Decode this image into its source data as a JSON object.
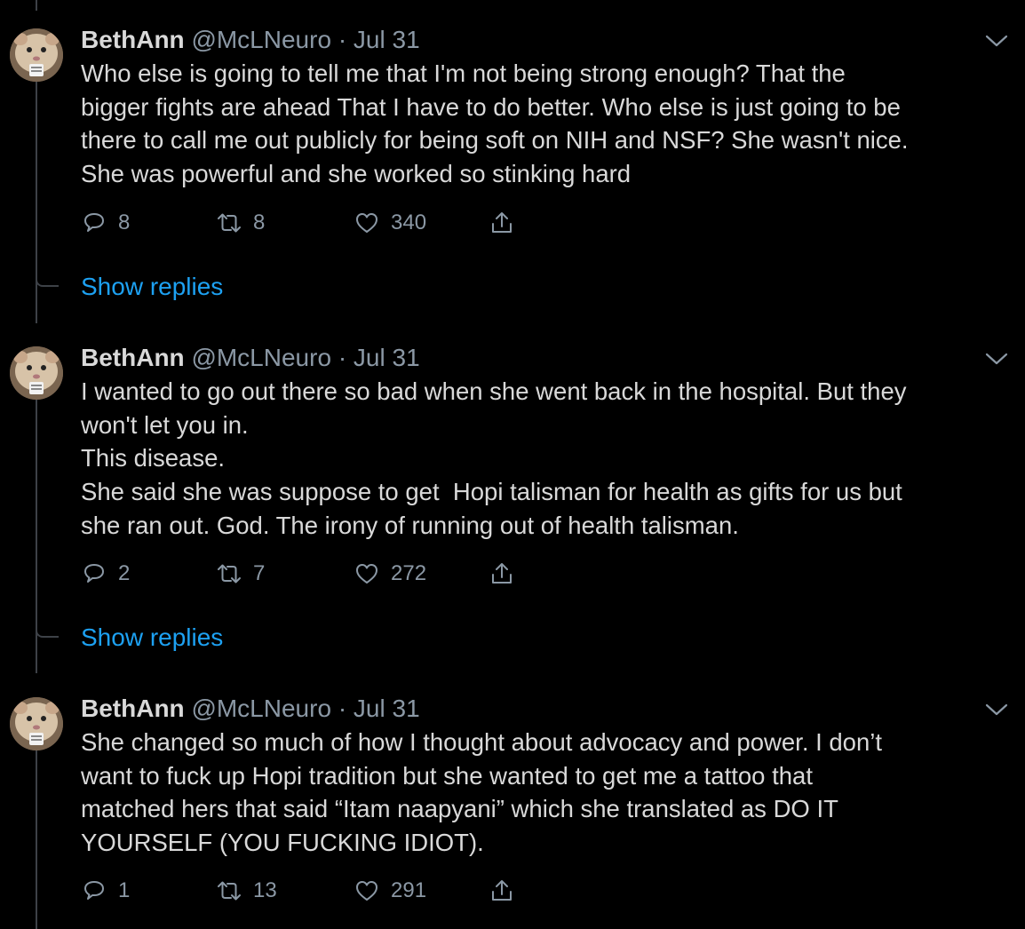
{
  "colors": {
    "background": "#000000",
    "text": "#d9d9d9",
    "muted": "#8b98a5",
    "link": "#1da1f2",
    "thread_line": "#3d4147"
  },
  "show_replies_label": "Show replies",
  "tweets": [
    {
      "name": "BethAnn",
      "handle": "@McLNeuro",
      "separator": "·",
      "date": "Jul 31",
      "lines": [
        "Who else is going to tell me that I'm not being strong enough? That the",
        "bigger fights are ahead That I have to do better. Who else is just going to be",
        "there to call me out publicly for being soft on NIH and NSF? She wasn't nice.",
        "She was powerful and she worked so stinking hard"
      ],
      "replies": "8",
      "retweets": "8",
      "likes": "340",
      "icons": [
        "avatar",
        "chevron-down-icon",
        "reply-icon",
        "retweet-icon",
        "like-icon",
        "share-icon"
      ]
    },
    {
      "name": "BethAnn",
      "handle": "@McLNeuro",
      "separator": "·",
      "date": "Jul 31",
      "lines": [
        "I wanted to go out there so bad when she went back in the hospital. But they",
        "won't let you in.",
        "This disease.",
        "She said she was suppose to get  Hopi talisman for health as gifts for us but",
        "she ran out. God. The irony of running out of health talisman."
      ],
      "replies": "2",
      "retweets": "7",
      "likes": "272",
      "icons": [
        "avatar",
        "chevron-down-icon",
        "reply-icon",
        "retweet-icon",
        "like-icon",
        "share-icon"
      ]
    },
    {
      "name": "BethAnn",
      "handle": "@McLNeuro",
      "separator": "·",
      "date": "Jul 31",
      "lines": [
        "She changed so much of how I thought about advocacy and power. I don’t",
        "want to fuck up Hopi tradition but she wanted to get me a tattoo that",
        "matched hers that said “Itam naapyani” which she translated as DO IT",
        "YOURSELF (YOU FUCKING IDIOT)."
      ],
      "replies": "1",
      "retweets": "13",
      "likes": "291",
      "icons": [
        "avatar",
        "chevron-down-icon",
        "reply-icon",
        "retweet-icon",
        "like-icon",
        "share-icon"
      ]
    }
  ]
}
